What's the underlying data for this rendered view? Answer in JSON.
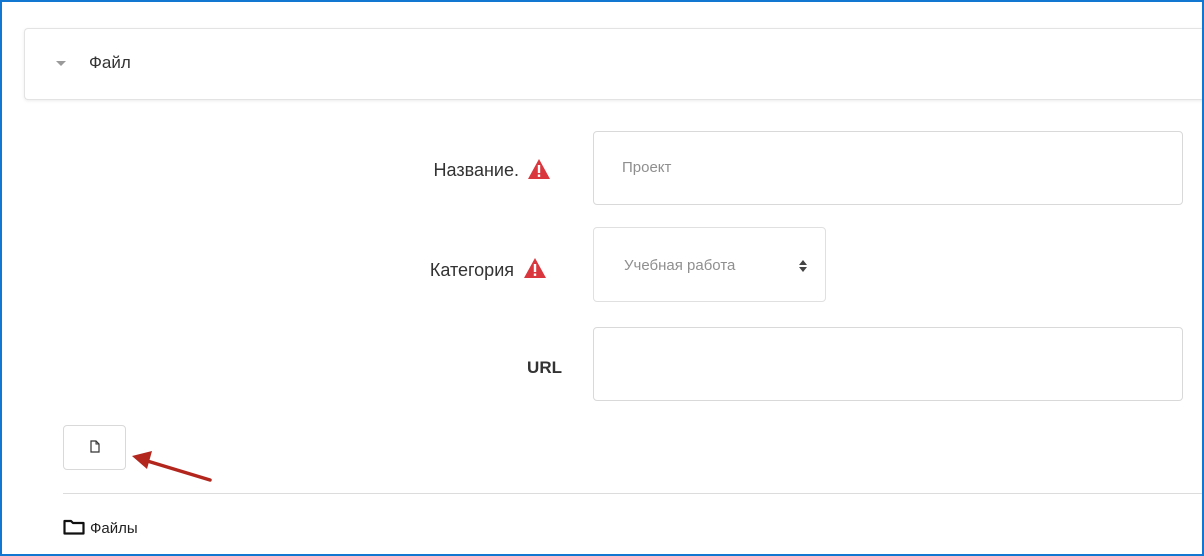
{
  "section": {
    "title": "Файл",
    "collapse_icon": "caret-down-icon"
  },
  "fields": {
    "name": {
      "label": "Название.",
      "placeholder": "Проект",
      "required_icon": "warning-icon"
    },
    "category": {
      "label": "Категория",
      "value": "Учебная работа",
      "required_icon": "warning-icon"
    },
    "url": {
      "label": "URL",
      "value": ""
    }
  },
  "file_button": {
    "icon": "file-icon"
  },
  "files": {
    "label": "Файлы",
    "icon": "folder-icon"
  },
  "colors": {
    "frame": "#1177d1",
    "warning": "#d9363e",
    "arrow": "#b3261e"
  }
}
